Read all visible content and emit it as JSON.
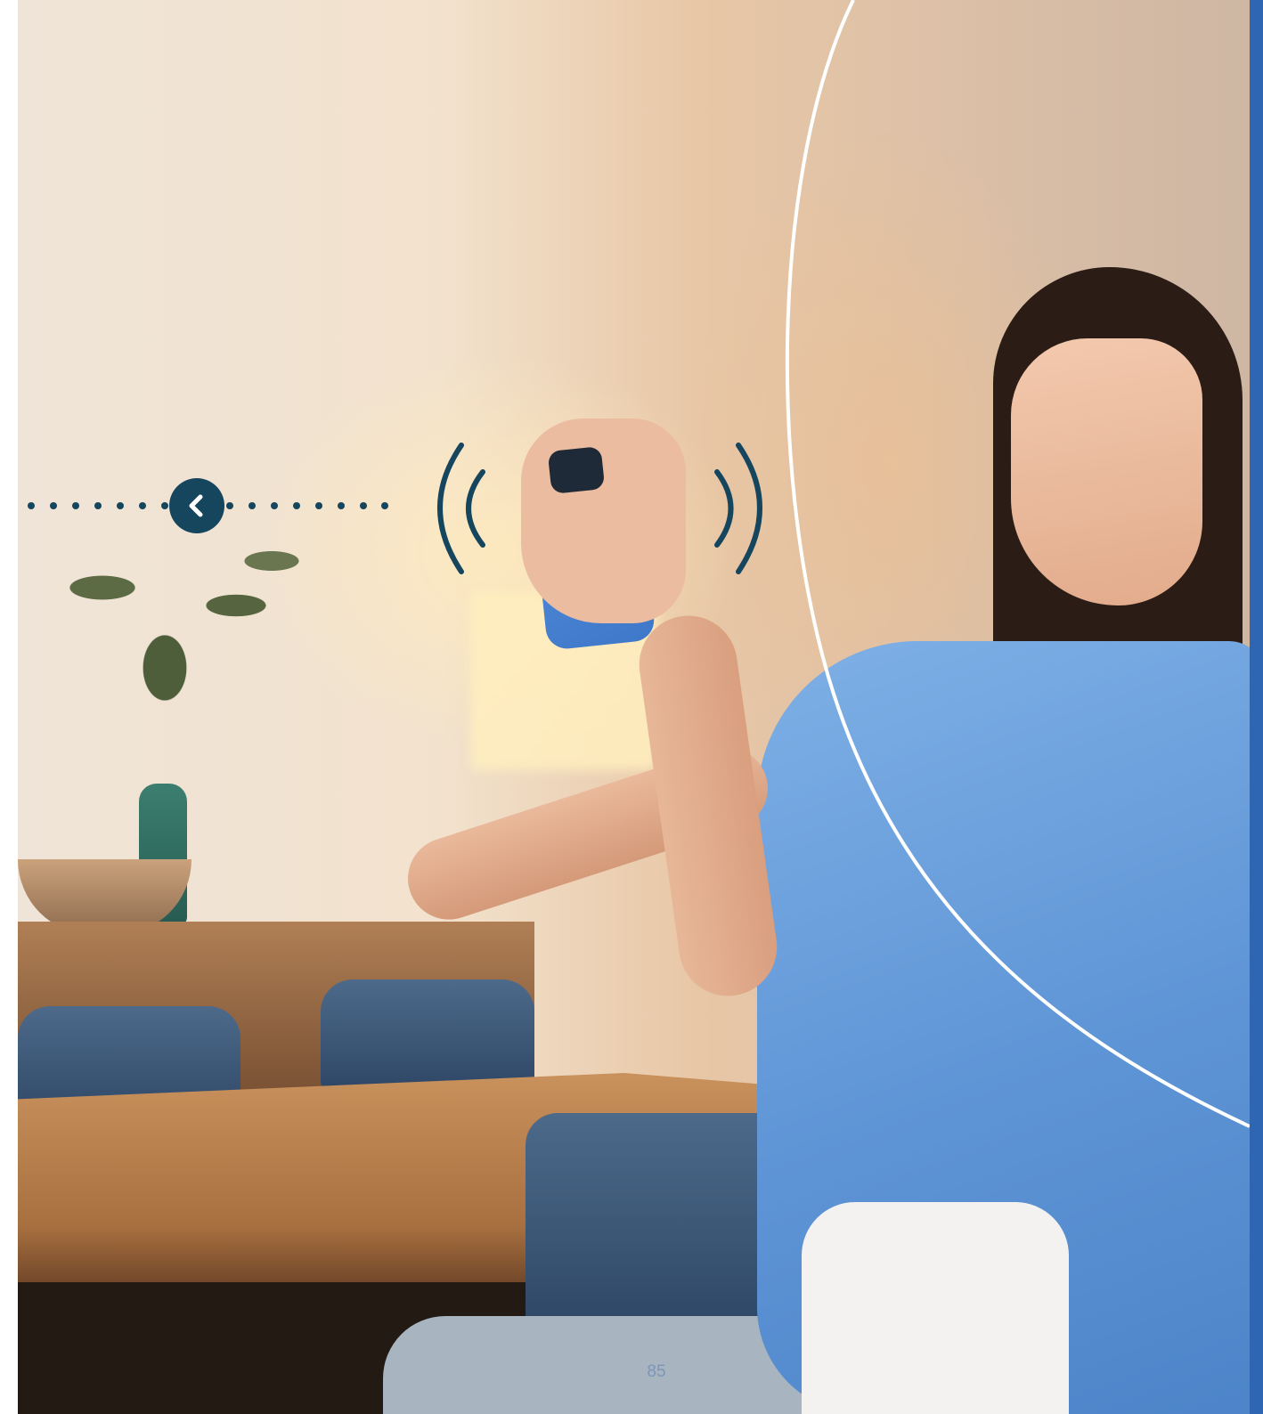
{
  "page": {
    "number": "85"
  },
  "navigation": {
    "back_icon": "chevron-left-icon"
  },
  "photo": {
    "subject_icon": "phone-vibration-icon"
  },
  "colors": {
    "accent_dark": "#16455e",
    "brand_blue": "#2f66b3",
    "arc_white": "#ffffff",
    "page_number": "#7d96b8"
  }
}
